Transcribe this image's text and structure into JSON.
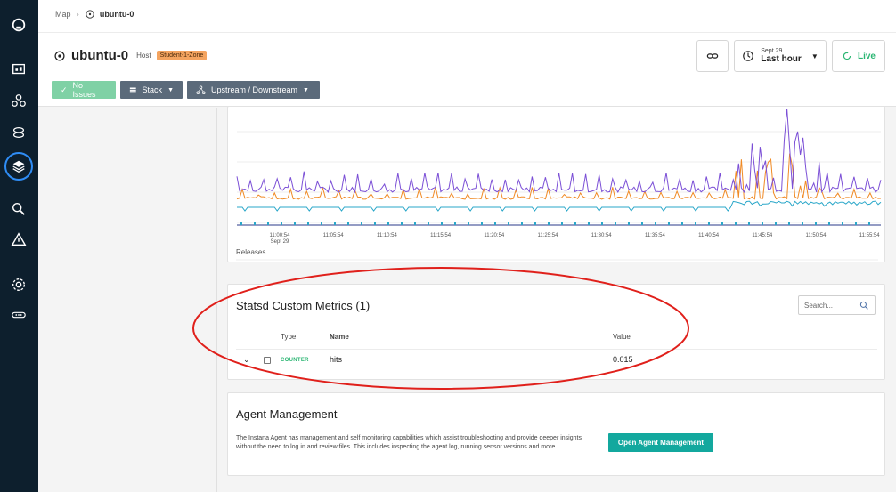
{
  "breadcrumb": {
    "root": "Map",
    "current": "ubuntu-0"
  },
  "entity": {
    "name": "ubuntu-0",
    "type": "Host",
    "zone": "Student-1-Zone"
  },
  "actions": {
    "date": "Sept 29",
    "range": "Last hour",
    "live": "Live"
  },
  "toolbar": {
    "issues": "No Issues",
    "stack": "Stack",
    "updown": "Upstream / Downstream"
  },
  "chart": {
    "tick_labels": [
      "11:00:54",
      "11:05:54",
      "11:10:54",
      "11:15:54",
      "11:20:54",
      "11:25:54",
      "11:30:54",
      "11:35:54",
      "11:40:54",
      "11:45:54",
      "11:50:54",
      "11:55:54"
    ],
    "first_tick_date": "Sept 29",
    "releases_label": "Releases"
  },
  "chart_data": {
    "type": "line",
    "x_ticks": [
      "11:00:54",
      "11:05:54",
      "11:10:54",
      "11:15:54",
      "11:20:54",
      "11:25:54",
      "11:30:54",
      "11:35:54",
      "11:40:54",
      "11:45:54",
      "11:50:54",
      "11:55:54"
    ],
    "series": [
      {
        "color": "#7b4fd6"
      },
      {
        "color": "#f08a24"
      },
      {
        "color": "#2aa7c9"
      }
    ],
    "grid": true,
    "legend": "none"
  },
  "metrics": {
    "title": "Statsd Custom Metrics (1)",
    "search_placeholder": "Search...",
    "columns": {
      "type": "Type",
      "name": "Name",
      "value": "Value"
    },
    "rows": [
      {
        "type": "COUNTER",
        "name": "hits",
        "value": "0.015"
      }
    ]
  },
  "agent": {
    "title": "Agent Management",
    "description": "The Instana Agent has management and self monitoring capabilities which assist troubleshooting and provide deeper insights without the need to log in and review files. This includes inspecting the agent log, running sensor versions and more.",
    "button": "Open Agent Management"
  },
  "colors": {
    "nav_bg": "#0d1f2d",
    "accent": "#2f8df5",
    "success": "#2bb673",
    "teal_button": "#13a89e",
    "annotation": "#e0201b"
  }
}
